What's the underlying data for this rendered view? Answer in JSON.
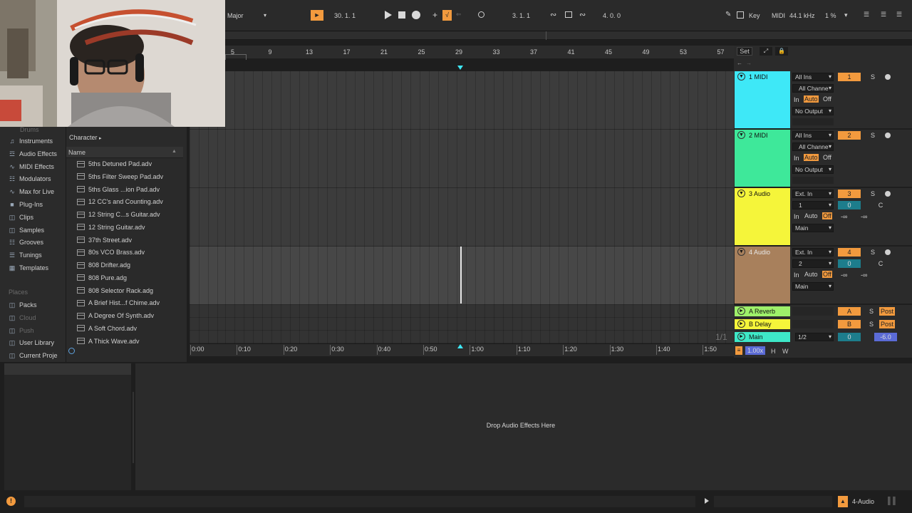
{
  "topbar": {
    "scale": "Major",
    "position": "30.  1.  1",
    "loop_start": "3.  1.  1",
    "loop_length": "4.  0.  0",
    "key_label": "Key",
    "midi_label": "MIDI",
    "sample_rate": "44.1 kHz",
    "cpu": "1 %"
  },
  "sidebar": {
    "partial_top": "Drums",
    "categories": [
      "Instruments",
      "Audio Effects",
      "MIDI Effects",
      "Modulators",
      "Max for Live",
      "Plug-Ins",
      "Clips",
      "Samples",
      "Grooves",
      "Tunings",
      "Templates"
    ],
    "places_header": "Places",
    "places": [
      "Packs",
      "Cloud",
      "Push",
      "User Library",
      "Current Proje"
    ]
  },
  "browser": {
    "filter_label": "Character",
    "column_header": "Name",
    "files": [
      "5ths Detuned Pad.adv",
      "5ths Filter Sweep Pad.adv",
      "5ths Glass ...ion Pad.adv",
      "12 CC's and Counting.adv",
      "12 String C...s Guitar.adv",
      "12 String Guitar.adv",
      "37th Street.adv",
      "80s VCO Brass.adv",
      "808 Drifter.adg",
      "808 Pure.adg",
      "808 Selector Rack.adg",
      "A Brief Hist...f Chime.adv",
      "A Degree Of Synth.adv",
      "A Soft Chord.adv",
      "A Thick Wave.adv"
    ]
  },
  "ruler": {
    "bars": [
      "5",
      "9",
      "13",
      "17",
      "21",
      "25",
      "29",
      "33",
      "37",
      "41",
      "45",
      "49",
      "53",
      "57"
    ],
    "set_label": "Set"
  },
  "timeline": {
    "times": [
      "0:00",
      "0:10",
      "0:20",
      "0:30",
      "0:40",
      "0:50",
      "1:00",
      "1:10",
      "1:20",
      "1:30",
      "1:40",
      "1:50"
    ],
    "page": "1/1"
  },
  "tracks": [
    {
      "name": "1 MIDI",
      "color": "#3ee8f7",
      "input": "All Ins",
      "channel": "All Channe",
      "monitor_in": "In",
      "monitor_auto": "Auto",
      "monitor_off": "Off",
      "output": "No Output",
      "number": "1",
      "solo": "S"
    },
    {
      "name": "2 MIDI",
      "color": "#3ee89a",
      "input": "All Ins",
      "channel": "All Channe",
      "monitor_in": "In",
      "monitor_auto": "Auto",
      "monitor_off": "Off",
      "output": "No Output",
      "number": "2",
      "solo": "S"
    },
    {
      "name": "3 Audio",
      "color": "#f5f53a",
      "input": "Ext. In",
      "channel": "1",
      "monitor_in": "In",
      "monitor_auto": "Auto",
      "monitor_off": "Off",
      "output": "Main",
      "number": "3",
      "solo": "S",
      "volume": "0",
      "pan": "C",
      "send_a": "-∞",
      "send_b": "-∞"
    },
    {
      "name": "4 Audio",
      "color": "#a8805c",
      "input": "Ext. In",
      "channel": "2",
      "monitor_in": "In",
      "monitor_auto": "Auto",
      "monitor_off": "Off",
      "output": "Main",
      "number": "4",
      "solo": "S",
      "volume": "0",
      "pan": "C",
      "send_a": "-∞",
      "send_b": "-∞"
    }
  ],
  "returns": [
    {
      "name": "A Reverb",
      "letter": "A",
      "solo": "S",
      "post": "Post"
    },
    {
      "name": "B Delay",
      "letter": "B",
      "solo": "S",
      "post": "Post"
    }
  ],
  "main": {
    "name": "Main",
    "routing": "1/2",
    "volume": "0",
    "level": "-6.0"
  },
  "zoom": {
    "value": "1.00x",
    "h": "H",
    "w": "W"
  },
  "device_drop_text": "Drop Audio Effects Here",
  "status": {
    "track": "4-Audio"
  }
}
